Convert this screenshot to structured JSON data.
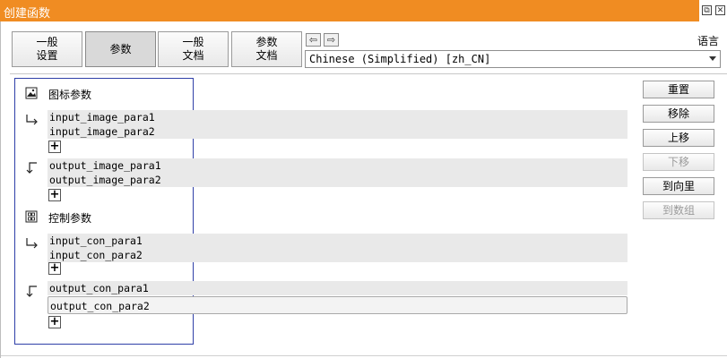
{
  "window": {
    "title": "创建函数",
    "restore_glyph": "⧉",
    "close_glyph": "✕"
  },
  "tabs": [
    {
      "label": "一般\n设置",
      "active": false
    },
    {
      "label": "参数",
      "active": true
    },
    {
      "label": "一般\n文档",
      "active": false
    },
    {
      "label": "参数\n文档",
      "active": false
    }
  ],
  "nav": {
    "prev_glyph": "⇦",
    "next_glyph": "⇨"
  },
  "language": {
    "label": "语言",
    "selected": "Chinese (Simplified) [zh_CN]"
  },
  "sections": {
    "icon_params": {
      "title": "图标参数",
      "icon": "image-icon"
    },
    "control_params": {
      "title": "控制参数",
      "icon": "control-icon"
    }
  },
  "params": {
    "input_image": [
      "input_image_para1",
      "input_image_para2"
    ],
    "output_image": [
      "output_image_para1",
      "output_image_para2"
    ],
    "input_con": [
      "input_con_para1",
      "input_con_para2"
    ],
    "output_con": [
      "output_con_para1",
      "output_con_para2"
    ]
  },
  "add_glyph": "+",
  "side_buttons": [
    {
      "label": "重置",
      "enabled": true
    },
    {
      "label": "移除",
      "enabled": true
    },
    {
      "label": "上移",
      "enabled": true
    },
    {
      "label": "下移",
      "enabled": false
    },
    {
      "label": "到向里",
      "enabled": true
    },
    {
      "label": "到数组",
      "enabled": false
    }
  ]
}
